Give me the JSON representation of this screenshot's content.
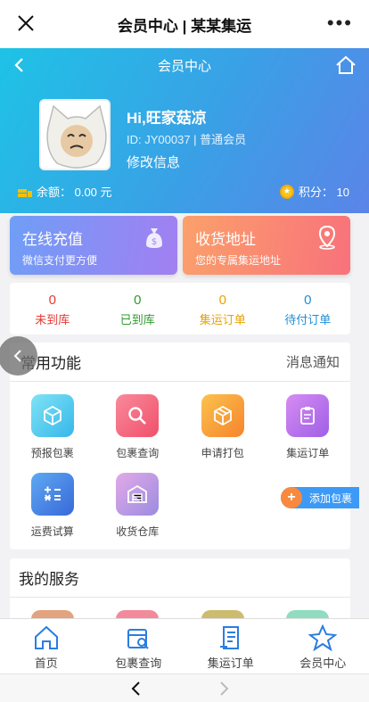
{
  "wechat": {
    "title": "会员中心 | 某某集运"
  },
  "header": {
    "nav_title": "会员中心",
    "username": "Hi,旺家菇凉",
    "user_id": "ID: JY00037 | 普通会员",
    "edit_label": "修改信息",
    "balance": "余额： 0.00 元",
    "points": "积分： 10"
  },
  "cards": [
    {
      "title": "在线充值",
      "sub": "微信支付更方便",
      "icon": "money-bag-icon"
    },
    {
      "title": "收货地址",
      "sub": "您的专属集运地址",
      "icon": "location-pin-icon"
    }
  ],
  "stats": [
    {
      "count": "0",
      "label": "未到库",
      "color": "#e53935"
    },
    {
      "count": "0",
      "label": "已到库",
      "color": "#2e9b2e"
    },
    {
      "count": "0",
      "label": "集运订单",
      "color": "#e8a200"
    },
    {
      "count": "0",
      "label": "待付订单",
      "color": "#1f8fd8"
    }
  ],
  "functions": {
    "title": "常用功能",
    "notice": "消息通知",
    "items": [
      {
        "label": "预报包裹",
        "icon": "box-icon"
      },
      {
        "label": "包裹查询",
        "icon": "search-icon"
      },
      {
        "label": "申请打包",
        "icon": "package-icon"
      },
      {
        "label": "集运订单",
        "icon": "clipboard-icon"
      },
      {
        "label": "运费试算",
        "icon": "calculator-icon"
      },
      {
        "label": "收货仓库",
        "icon": "warehouse-icon"
      }
    ],
    "add_package": "添加包裹"
  },
  "services": {
    "title": "我的服务"
  },
  "tabbar": [
    {
      "label": "首页",
      "icon": "home-icon"
    },
    {
      "label": "包裹查询",
      "icon": "parcel-search-icon"
    },
    {
      "label": "集运订单",
      "icon": "order-list-icon"
    },
    {
      "label": "会员中心",
      "icon": "star-icon"
    }
  ]
}
